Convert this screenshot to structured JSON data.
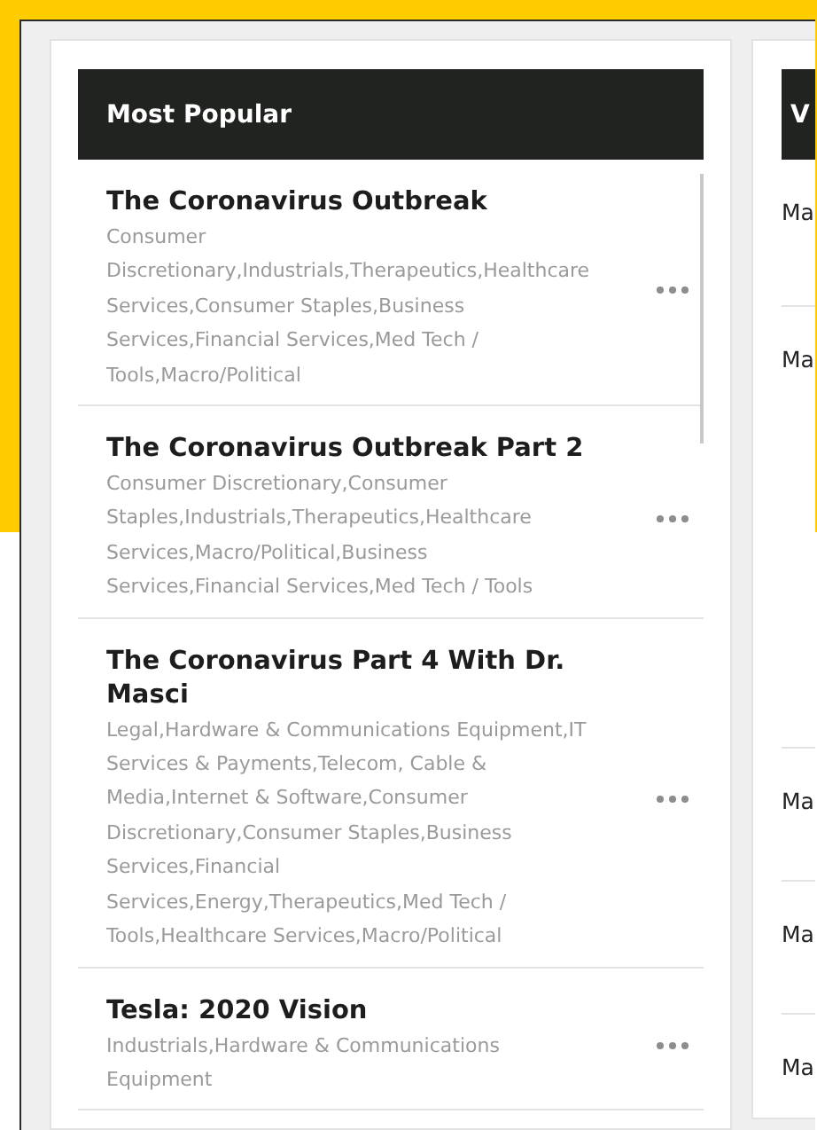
{
  "most_popular": {
    "header": "Most Popular",
    "items": [
      {
        "title": "The Coronavirus Outbreak",
        "tags": "Consumer Discretionary,Industrials,Therapeutics,Healthcare Services,Consumer Staples,Business Services,Financial Services,Med Tech / Tools,Macro/Political"
      },
      {
        "title": "The Coronavirus Outbreak Part 2",
        "tags": "Consumer Discretionary,Consumer Staples,Industrials,Therapeutics,Healthcare Services,Macro/Political,Business Services,Financial Services,Med Tech / Tools"
      },
      {
        "title": "The Coronavirus Part 4 With Dr. Masci",
        "tags": "Legal,Hardware & Communications Equipment,IT Services & Payments,Telecom, Cable & Media,Internet & Software,Consumer Discretionary,Consumer Staples,Business Services,Financial Services,Energy,Therapeutics,Med Tech / Tools,Healthcare Services,Macro/Political"
      },
      {
        "title": "Tesla: 2020 Vision",
        "tags": "Industrials,Hardware & Communications Equipment"
      }
    ]
  },
  "second_panel": {
    "header": "V",
    "items": [
      "Ma",
      "Ma",
      "Ma",
      "Ma",
      "Ma"
    ]
  }
}
